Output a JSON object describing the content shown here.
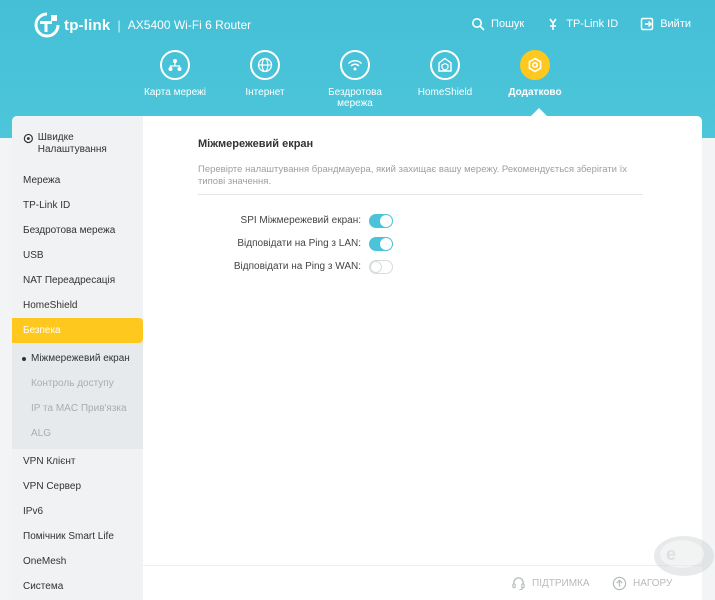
{
  "header": {
    "brand": "tp-link",
    "separator": "|",
    "model": "AX5400 Wi-Fi 6 Router",
    "links": [
      {
        "label": "Пошук",
        "icon": "search-icon"
      },
      {
        "label": "TP-Link ID",
        "icon": "user-id-icon"
      },
      {
        "label": "Вийти",
        "icon": "logout-icon"
      }
    ]
  },
  "nav": {
    "items": [
      {
        "label": "Карта мережі",
        "icon": "network-map-icon",
        "active": false
      },
      {
        "label": "Інтернет",
        "icon": "globe-icon",
        "active": false
      },
      {
        "label": "Бездротова мережа",
        "icon": "wifi-icon",
        "active": false
      },
      {
        "label": "HomeShield",
        "icon": "home-shield-icon",
        "active": false
      },
      {
        "label": "Додатково",
        "icon": "gear-icon",
        "active": true
      }
    ]
  },
  "sidebar": {
    "quick_setup": "Швидке Налаштування",
    "items_top": [
      "Мережа",
      "TP-Link ID",
      "Бездротова мережа",
      "USB",
      "NAT Переадресація",
      "HomeShield"
    ],
    "active": "Безпека",
    "sub_items": [
      "Міжмережевий екран",
      "Контроль доступу",
      "IP та MAC Прив'язка",
      "ALG"
    ],
    "items_bottom": [
      "VPN Клієнт",
      "VPN Сервер",
      "IPv6",
      "Помічник Smart Life",
      "OneMesh",
      "Система"
    ]
  },
  "content": {
    "title": "Міжмережевий екран",
    "description": "Перевірте налаштування брандмауера, який захищає вашу мережу. Рекомендується зберігати їх типові значення.",
    "settings": [
      {
        "label": "SPI Міжмережевий екран:",
        "enabled": true
      },
      {
        "label": "Відповідати на Ping з LAN:",
        "enabled": true
      },
      {
        "label": "Відповідати на Ping з WAN:",
        "enabled": false
      }
    ]
  },
  "footer": {
    "support": "ПІДТРИМКА",
    "back_to_top": "НАГОРУ"
  },
  "colors": {
    "header": "#4bc3d8",
    "accent": "#ffc81e",
    "toggle_on": "#4bc3d8"
  }
}
